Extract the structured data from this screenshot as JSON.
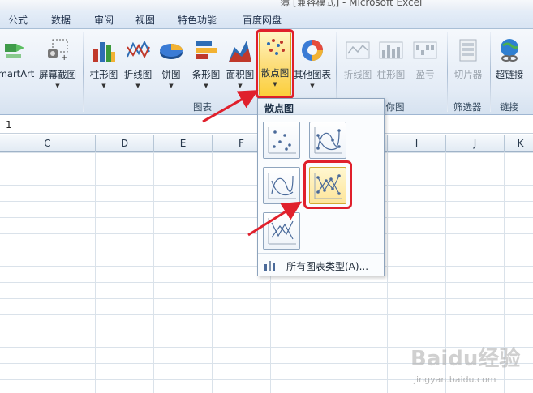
{
  "window": {
    "title": "簿 [兼容模式] - Microsoft Excel"
  },
  "tabs": [
    "公式",
    "数据",
    "审阅",
    "视图",
    "特色功能",
    "百度网盘"
  ],
  "ribbon": {
    "buttons": {
      "smartart": "martArt",
      "screenshot": "屏幕截图",
      "column": "柱形图",
      "line": "折线图",
      "pie": "饼图",
      "bar": "条形图",
      "area": "面积图",
      "scatter": "散点图",
      "other": "其他图表",
      "spark_line": "折线图",
      "spark_column": "柱形图",
      "spark_winloss": "盈亏",
      "slicer": "切片器",
      "hyperlink": "超链接"
    },
    "groups": {
      "charts": "图表",
      "sparklines": "迷你图",
      "filter": "筛选器",
      "links": "链接"
    }
  },
  "formula_bar": {
    "value": "1"
  },
  "columns": [
    "C",
    "D",
    "E",
    "F",
    "G",
    "H",
    "I",
    "J",
    "K"
  ],
  "dropdown": {
    "title": "散点图",
    "chart_types": [
      {
        "name": "仅带数据标记的散点图",
        "selected": false
      },
      {
        "name": "带平滑线和数据标记的散点图",
        "selected": false
      },
      {
        "name": "带平滑线的散点图",
        "selected": false
      },
      {
        "name": "带直线和数据标记的散点图",
        "selected": true
      },
      {
        "name": "带直线的散点图",
        "selected": false
      }
    ],
    "all_types": "所有图表类型(A)..."
  },
  "watermark": {
    "brand": "Baidu经验",
    "url": "jingyan.baidu.com"
  },
  "colors": {
    "highlight": "#e0202c",
    "selected_fill": "#fde083",
    "ribbon_bg": "#e4ecf6"
  }
}
